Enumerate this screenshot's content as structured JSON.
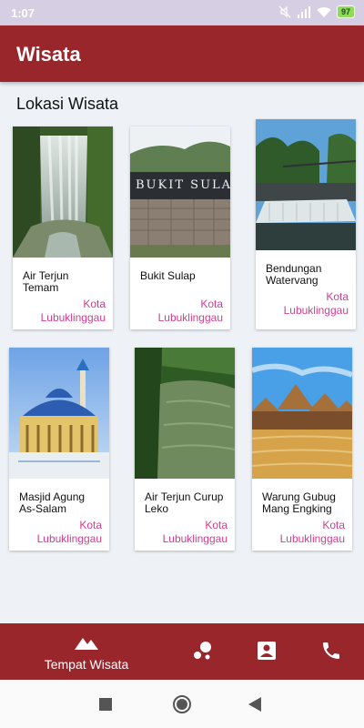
{
  "status_bar": {
    "time": "1:07",
    "battery": "97",
    "icons": [
      "mute-icon",
      "signal-icon",
      "wifi-icon",
      "battery-icon"
    ]
  },
  "app_bar": {
    "title": "Wisata"
  },
  "section": {
    "title": "Lokasi Wisata"
  },
  "places": [
    {
      "name": "Air Terjun Temam",
      "city": "Kota Lubuklinggau"
    },
    {
      "name": "Bukit Sulap",
      "city": "Kota Lubuklinggau"
    },
    {
      "name": "Bendungan Watervang",
      "city": "Kota Lubuklinggau"
    },
    {
      "name": "Masjid Agung As-Salam",
      "city": "Kota Lubuklinggau"
    },
    {
      "name": "Air Terjun Curup Leko",
      "city": "Kota Lubuklinggau"
    },
    {
      "name": "Warung Gubug Mang Engking",
      "city": "Kota Lubuklinggau"
    }
  ],
  "bottom_nav": {
    "home_label": "Tempat Wisata",
    "icons": [
      "mountain-icon",
      "bubble-chart-icon",
      "contact-card-icon",
      "phone-icon"
    ]
  },
  "colors": {
    "primary": "#99262b",
    "accent": "#d13e8d",
    "status_bar": "#d6cfe3"
  }
}
